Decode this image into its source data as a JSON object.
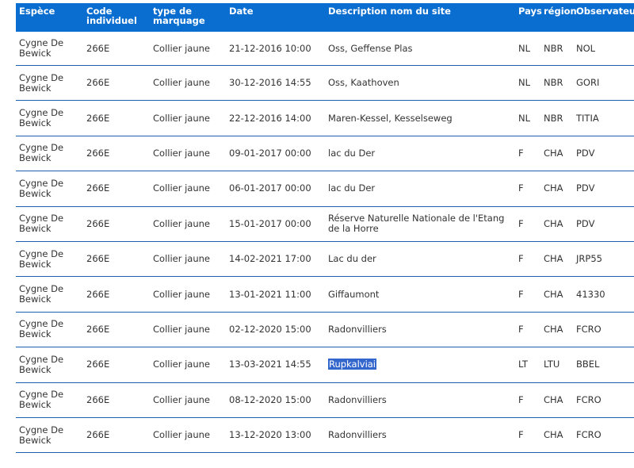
{
  "headers": [
    "Espèce",
    "Code individuel",
    "type de marquage",
    "Date",
    "Description nom du site",
    "Pays",
    "région",
    "Observateur"
  ],
  "rows": [
    {
      "espece": "Cygne De Bewick",
      "code": "266E",
      "marquage": "Collier jaune",
      "date": "21-12-2016 10:00",
      "site": "Oss, Geffense Plas",
      "pays": "NL",
      "region": "NBR",
      "observateur": "NOL"
    },
    {
      "espece": "Cygne De Bewick",
      "code": "266E",
      "marquage": "Collier jaune",
      "date": "30-12-2016 14:55",
      "site": "Oss, Kaathoven",
      "pays": "NL",
      "region": "NBR",
      "observateur": "GORI"
    },
    {
      "espece": "Cygne De Bewick",
      "code": "266E",
      "marquage": "Collier jaune",
      "date": "22-12-2016 14:00",
      "site": "Maren-Kessel, Kesselseweg",
      "pays": "NL",
      "region": "NBR",
      "observateur": "TITIA"
    },
    {
      "espece": "Cygne De Bewick",
      "code": "266E",
      "marquage": "Collier jaune",
      "date": "09-01-2017 00:00",
      "site": "lac du Der",
      "pays": "F",
      "region": "CHA",
      "observateur": "PDV"
    },
    {
      "espece": "Cygne De Bewick",
      "code": "266E",
      "marquage": "Collier jaune",
      "date": "06-01-2017 00:00",
      "site": "lac du Der",
      "pays": "F",
      "region": "CHA",
      "observateur": "PDV"
    },
    {
      "espece": "Cygne De Bewick",
      "code": "266E",
      "marquage": "Collier jaune",
      "date": "15-01-2017 00:00",
      "site": "Réserve Naturelle Nationale de l'Etang de la Horre",
      "pays": "F",
      "region": "CHA",
      "observateur": "PDV"
    },
    {
      "espece": "Cygne De Bewick",
      "code": "266E",
      "marquage": "Collier jaune",
      "date": "14-02-2021 17:00",
      "site": "Lac du der",
      "pays": "F",
      "region": "CHA",
      "observateur": "JRP55"
    },
    {
      "espece": "Cygne De Bewick",
      "code": "266E",
      "marquage": "Collier jaune",
      "date": "13-01-2021 11:00",
      "site": "Giffaumont",
      "pays": "F",
      "region": "CHA",
      "observateur": "41330"
    },
    {
      "espece": "Cygne De Bewick",
      "code": "266E",
      "marquage": "Collier jaune",
      "date": "02-12-2020 15:00",
      "site": "Radonvilliers",
      "pays": "F",
      "region": "CHA",
      "observateur": "FCRO"
    },
    {
      "espece": "Cygne De Bewick",
      "code": "266E",
      "marquage": "Collier jaune",
      "date": "13-03-2021 14:55",
      "site": "Rupkalviai",
      "pays": "LT",
      "region": "LTU",
      "observateur": "BBEL",
      "selected": true
    },
    {
      "espece": "Cygne De Bewick",
      "code": "266E",
      "marquage": "Collier jaune",
      "date": "08-12-2020 15:00",
      "site": "Radonvilliers",
      "pays": "F",
      "region": "CHA",
      "observateur": "FCRO"
    },
    {
      "espece": "Cygne De Bewick",
      "code": "266E",
      "marquage": "Collier jaune",
      "date": "13-12-2020 13:00",
      "site": "Radonvilliers",
      "pays": "F",
      "region": "CHA",
      "observateur": "FCRO"
    }
  ]
}
